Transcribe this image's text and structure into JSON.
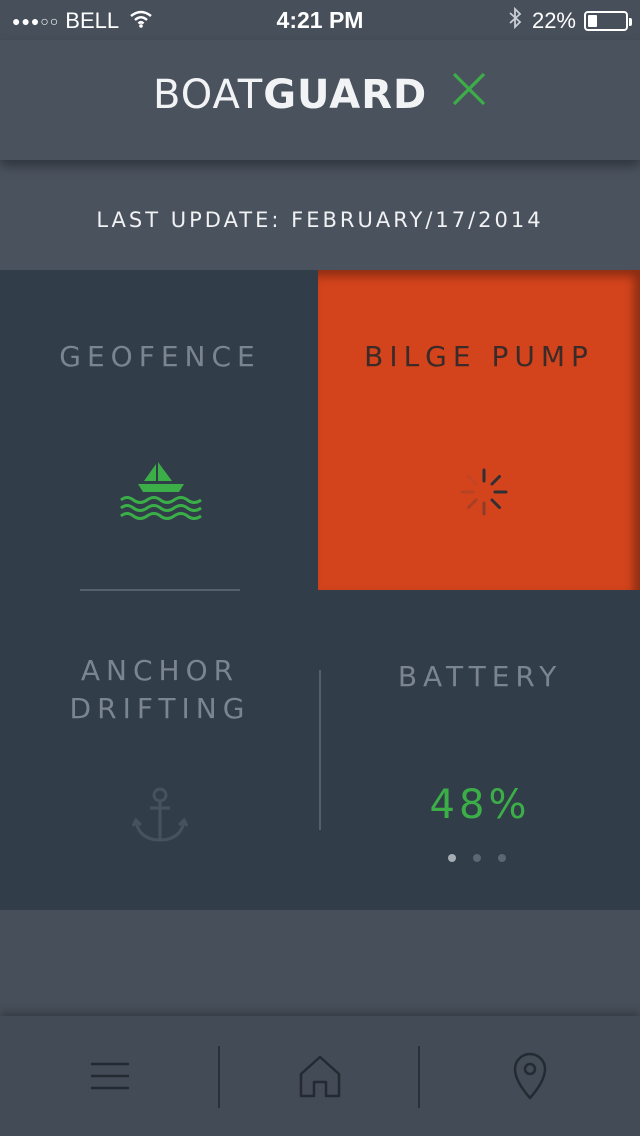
{
  "status_bar": {
    "signal": "●●●○○",
    "carrier": "BELL",
    "time": "4:21 PM",
    "battery_percent": "22%",
    "battery_level": 0.22,
    "icons": [
      "signal-dots-icon",
      "wifi-icon",
      "bluetooth-icon",
      "battery-icon"
    ]
  },
  "header": {
    "logo_light": "BOAT",
    "logo_bold": "GUARD",
    "logo_icon": "x-mark-icon",
    "accent_color": "#3cae48"
  },
  "update": {
    "text": "LAST UPDATE: FEBRUARY/17/2014"
  },
  "tiles": {
    "geofence": {
      "title": "GEOFENCE",
      "icon": "boat-icon",
      "status_color": "#3cae48"
    },
    "bilge_pump": {
      "title": "BILGE PUMP",
      "icon": "loading-spinner-icon",
      "background_color": "#d4441c"
    },
    "anchor": {
      "title_line1": "ANCHOR",
      "title_line2": "DRIFTING",
      "icon": "anchor-icon"
    },
    "battery": {
      "title": "BATTERY",
      "value": "48%",
      "level": 0.48
    }
  },
  "pager": {
    "count": 3,
    "active_index": 0
  },
  "tab_bar": {
    "items": [
      {
        "name": "menu",
        "icon": "hamburger-menu-icon"
      },
      {
        "name": "home",
        "icon": "home-icon"
      },
      {
        "name": "location",
        "icon": "map-pin-icon"
      }
    ]
  }
}
